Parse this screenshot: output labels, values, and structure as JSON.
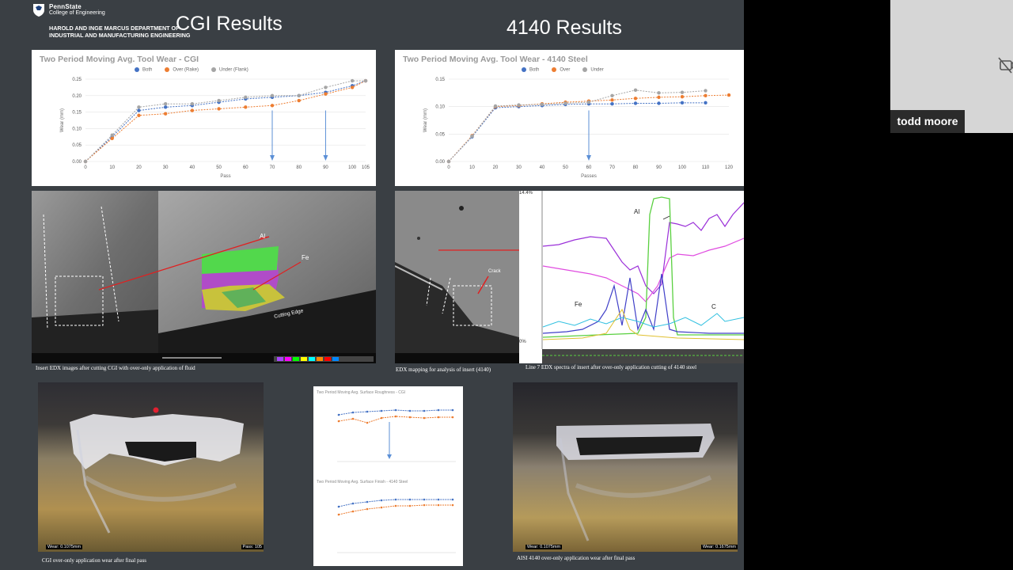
{
  "header": {
    "university": "PennState",
    "college": "College of Engineering",
    "department": "HAROLD AND INGE MARCUS DEPARTMENT OF INDUSTRIAL AND MANUFACTURING ENGINEERING"
  },
  "titles": {
    "cgi": "CGI Results",
    "steel": "4140 Results"
  },
  "colors": {
    "both": "#4472c4",
    "over": "#ed7d31",
    "under": "#a5a5a5",
    "slide_bg": "#3a3f44"
  },
  "chart_data": [
    {
      "type": "line",
      "title": "Two Period Moving Avg. Tool Wear - CGI",
      "xlabel": "Pass",
      "ylabel": "Wear (mm)",
      "x": [
        0,
        10,
        20,
        30,
        40,
        50,
        60,
        70,
        80,
        90,
        100,
        105
      ],
      "xticks": [
        "0",
        "10",
        "20",
        "30",
        "40",
        "50",
        "60",
        "70",
        "80",
        "90",
        "100",
        "105"
      ],
      "yticks": [
        "0.00",
        "0.05",
        "0.10",
        "0.15",
        "0.20",
        "0.25"
      ],
      "ylim": [
        0,
        0.25
      ],
      "series": [
        {
          "name": "Both",
          "values": [
            0.0,
            0.075,
            0.155,
            0.165,
            0.17,
            0.18,
            0.19,
            0.195,
            0.2,
            0.21,
            0.23,
            0.245
          ]
        },
        {
          "name": "Over (Rake)",
          "values": [
            0.0,
            0.07,
            0.14,
            0.145,
            0.155,
            0.16,
            0.165,
            0.17,
            0.185,
            0.205,
            0.225,
            0.245
          ]
        },
        {
          "name": "Under (Flank)",
          "values": [
            0.0,
            0.08,
            0.165,
            0.175,
            0.175,
            0.185,
            0.195,
            0.2,
            0.2,
            0.225,
            0.245,
            0.245
          ]
        }
      ],
      "arrows_x": [
        70,
        90
      ]
    },
    {
      "type": "line",
      "title": "Two Period Moving Avg. Tool Wear - 4140 Steel",
      "xlabel": "Passes",
      "ylabel": "Wear (mm)",
      "x": [
        0,
        10,
        20,
        30,
        40,
        50,
        60,
        70,
        80,
        90,
        100,
        110,
        120
      ],
      "xticks": [
        "0",
        "10",
        "20",
        "30",
        "40",
        "50",
        "60",
        "70",
        "80",
        "90",
        "100",
        "110",
        "120"
      ],
      "yticks": [
        "0.00",
        "0.05",
        "0.10",
        "0.15"
      ],
      "ylim": [
        0,
        0.15
      ],
      "series": [
        {
          "name": "Both",
          "values": [
            0.0,
            0.045,
            0.098,
            0.1,
            0.102,
            0.104,
            0.105,
            0.105,
            0.106,
            0.106,
            0.107,
            0.107,
            null
          ]
        },
        {
          "name": "Over",
          "values": [
            0.0,
            0.047,
            0.1,
            0.102,
            0.105,
            0.108,
            0.11,
            0.112,
            0.115,
            0.117,
            0.118,
            0.12,
            0.121
          ]
        },
        {
          "name": "Under",
          "values": [
            0.0,
            0.046,
            0.101,
            0.103,
            0.104,
            0.106,
            0.108,
            0.12,
            0.13,
            0.125,
            0.126,
            0.129,
            null
          ]
        }
      ],
      "arrows_x": [
        60
      ]
    }
  ],
  "images": {
    "cgi_edx_caption": "Insert EDX images after cutting CGI with over-only application of fluid",
    "cgi_al_label": "Al",
    "cgi_fe_label": "Fe",
    "cgi_edge_label": "Cutting Edge",
    "steel_edx_caption": "EDX mapping for analysis of insert (4140)",
    "steel_spectra_caption": "Line 7 EDX spectra of insert after over-only application cutting of 4140 steel",
    "steel_crack_label": "Crack",
    "spectra_al": "Al",
    "spectra_fe": "Fe",
    "spectra_c": "C",
    "spectra_top": "14.4%",
    "spectra_bottom": "0%",
    "cgi_wear_caption": "CGI over-only application wear after final pass",
    "cgi_wear_tag": "Wear: 0.1075mm",
    "cgi_pass_tag": "Pass: 105",
    "steel_wear_caption": "AISI 4140  over-only application wear after final pass",
    "steel_wear_tag_left": "Wear: 0.1075mm",
    "steel_wear_tag_right": "Wear: 0.1675mm",
    "rough_title_cgi": "Two Period Moving Avg. Surface Roughness - CGI",
    "rough_title_steel": "Two Period Moving Avg. Surface Finish - 4140 Steel"
  },
  "participant": {
    "name": "todd moore",
    "camera_icon": "camera-off-icon"
  }
}
